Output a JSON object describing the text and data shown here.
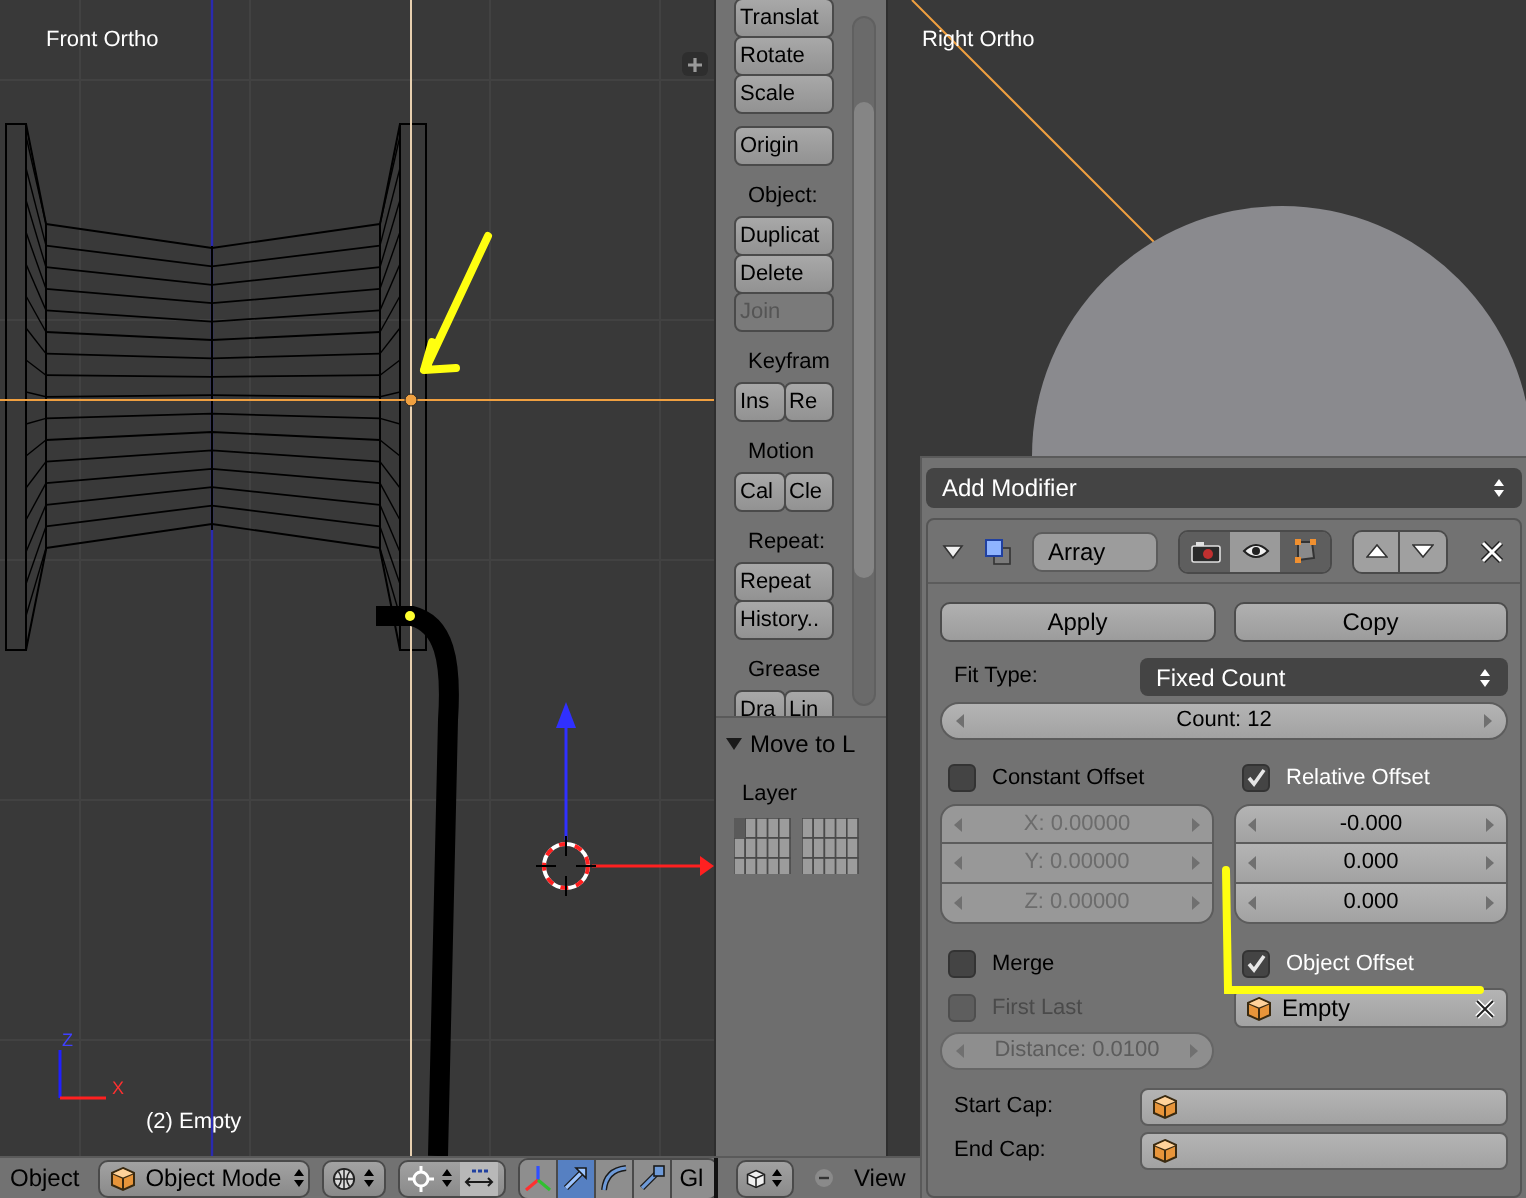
{
  "left_viewport": {
    "title": "Front Ortho",
    "object_label": "(2) Empty",
    "axis_labels": [
      "Z",
      "X"
    ]
  },
  "tool_shelf": {
    "groups": [
      {
        "rows": [
          [
            {
              "label": "Translat",
              "disabled": false
            }
          ],
          [
            {
              "label": "Rotate",
              "disabled": false
            }
          ],
          [
            {
              "label": "Scale",
              "disabled": false
            }
          ]
        ]
      },
      {
        "rows": [
          [
            {
              "label": "Origin",
              "disabled": false
            }
          ]
        ]
      },
      {
        "heading": "Object:",
        "rows": [
          [
            {
              "label": "Duplicat",
              "disabled": false
            }
          ],
          [
            {
              "label": "Delete",
              "disabled": false
            }
          ],
          [
            {
              "label": "Join",
              "disabled": true
            }
          ]
        ]
      },
      {
        "heading": "Keyfram",
        "rows": [
          [
            {
              "label": "Ins",
              "disabled": false
            },
            {
              "label": "Re",
              "disabled": false
            }
          ]
        ]
      },
      {
        "heading": "Motion",
        "rows": [
          [
            {
              "label": "Cal",
              "disabled": false
            },
            {
              "label": "Cle",
              "disabled": false
            }
          ]
        ]
      },
      {
        "heading": "Repeat:",
        "rows": [
          [
            {
              "label": "Repeat",
              "disabled": false
            }
          ],
          [
            {
              "label": "History..",
              "disabled": false
            }
          ]
        ]
      },
      {
        "heading": "Grease",
        "rows": [
          [
            {
              "label": "Dra",
              "disabled": false
            },
            {
              "label": "Lin",
              "disabled": false
            }
          ]
        ]
      }
    ]
  },
  "move_panel": {
    "title": "Move to L",
    "expanded": true,
    "layer_label": "Layer"
  },
  "right_viewport": {
    "title": "Right Ortho"
  },
  "modifier_panel": {
    "add_modifier": "Add Modifier",
    "modifier": {
      "name": "Array",
      "expanded": true,
      "render": true,
      "viewport": false,
      "editmode": true
    },
    "buttons": [
      "Apply",
      "Copy"
    ],
    "fit_type": {
      "label": "Fit Type:",
      "value": "Fixed Count"
    },
    "count": "Count: 12",
    "constant_offset": {
      "label": "Constant Offset",
      "checked": false,
      "fields": [
        "X: 0.00000",
        "Y: 0.00000",
        "Z: 0.00000"
      ]
    },
    "relative_offset": {
      "label": "Relative Offset",
      "checked": true,
      "fields": [
        "-0.000",
        "0.000",
        "0.000"
      ]
    },
    "merge": {
      "label": "Merge",
      "checked": false
    },
    "first_last": {
      "label": "First Last",
      "checked": false
    },
    "distance": "Distance: 0.0100",
    "object_offset": {
      "label": "Object Offset",
      "checked": true,
      "object": "Empty"
    },
    "caps": [
      {
        "label": "Start Cap:"
      },
      {
        "label": "End Cap:"
      }
    ]
  },
  "header": {
    "menu": "Object",
    "mode": "Object Mode",
    "manipulators": [
      {
        "kind": "axes",
        "selected": false
      },
      {
        "kind": "translate",
        "selected": true
      },
      {
        "kind": "rotate",
        "selected": false
      },
      {
        "kind": "scale",
        "selected": false
      }
    ],
    "cut_label": "Gl",
    "view_menu": "View"
  }
}
